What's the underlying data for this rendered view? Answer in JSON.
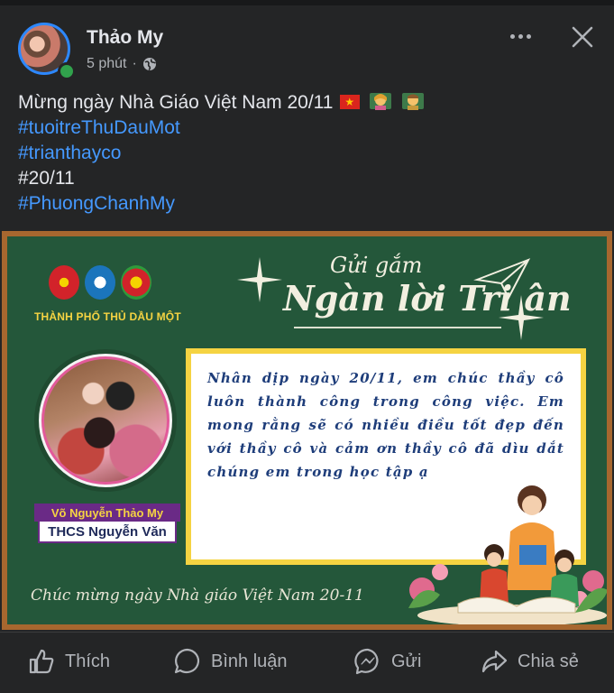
{
  "post": {
    "author": "Thảo My",
    "time": "5 phút",
    "separator": "·",
    "audience_icon": "globe-icon"
  },
  "caption": {
    "line1": "Mừng ngày Nhà Giáo Việt Nam 20/11",
    "hashtag1": "#tuoitreThuDauMot",
    "hashtag2": "#trianthayco",
    "line4": "#20/11",
    "hashtag3": "#PhuongChanhMy"
  },
  "card": {
    "organization": "THÀNH PHỐ THỦ DẦU MỘT",
    "title_small": "Gửi gắm",
    "title_big": "Ngàn lời Tri ân",
    "message": "Nhân dịp ngày 20/11, em chúc thầy cô luôn thành công trong công việc. Em mong rằng sẽ có nhiều điều tốt đẹp đến với thầy cô và cảm ơn thầy cô đã dìu dắt chúng em trong học tập ạ",
    "student_name": "Võ Nguyễn Thảo My",
    "school": "THCS Nguyễn Văn",
    "footer": "Chúc mừng ngày Nhà giáo Việt Nam 20-11"
  },
  "actions": {
    "like": "Thích",
    "comment": "Bình luận",
    "send": "Gửi",
    "share": "Chia sẻ"
  },
  "colors": {
    "background": "#242526",
    "link": "#4599ff",
    "board": "#24573a",
    "frame": "#a7672f",
    "accent_yellow": "#f5d342"
  }
}
